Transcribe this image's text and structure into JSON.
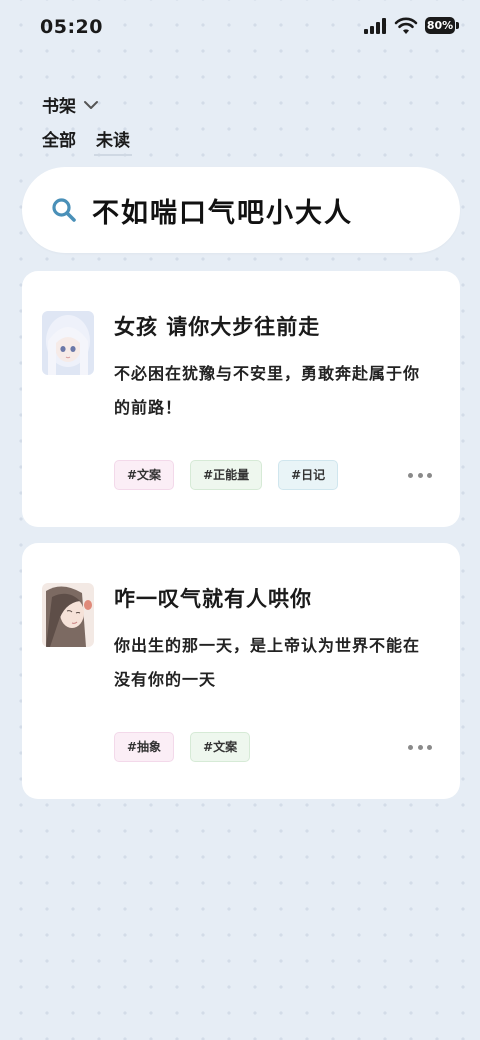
{
  "status_bar": {
    "time": "05:20",
    "battery": "80%"
  },
  "shelf": {
    "title": "书架"
  },
  "filters": [
    {
      "label": "全部"
    },
    {
      "label": "未读"
    }
  ],
  "search": {
    "query": "不如喘口气吧小大人"
  },
  "cards": [
    {
      "title": "女孩 请你大步往前走",
      "body": "不必困在犹豫与不安里，勇敢奔赴属于你的前路！",
      "tags": [
        "#文案",
        "#正能量",
        "#日记"
      ]
    },
    {
      "title": "咋一叹气就有人哄你",
      "body": "你出生的那一天，是上帝认为世界不能在没有你的一天",
      "tags": [
        "#抽象",
        "#文案"
      ]
    }
  ],
  "colors": {
    "background": "#e6edf5",
    "search_icon": "#4a90b8",
    "tag_pink": "#fbeef6",
    "tag_green": "#eef7ee",
    "tag_blue": "#e9f4f7"
  },
  "icons": [
    "signal-icon",
    "wifi-icon",
    "battery-icon",
    "chevron-down-icon",
    "search-icon",
    "more-icon"
  ]
}
